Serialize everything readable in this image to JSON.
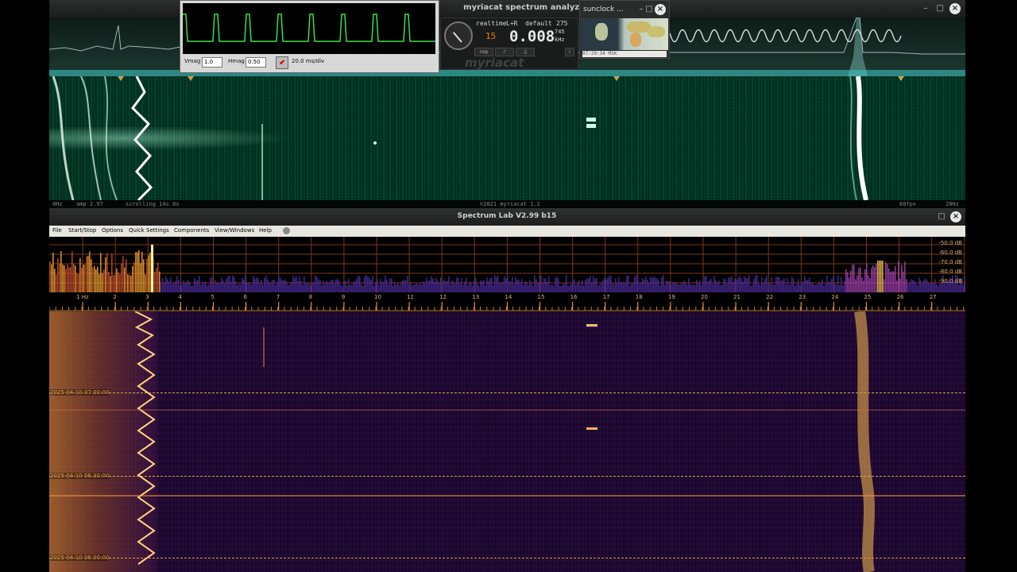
{
  "myriacat": {
    "title": "myriacat spectrum analyzer",
    "status": {
      "left_hz": "0Hz",
      "amp": "amp 2.97",
      "scrolling": "scrolling 14s 8s",
      "copyright": "©2021 myriacat 1.2",
      "fps": "60fps",
      "right_hz": "28Hz"
    },
    "panel": {
      "mode": "realtime",
      "channel": "L+R",
      "preset": "default",
      "digit": "15",
      "freq": "0.008",
      "num_top": "275",
      "num_mid": "745",
      "unit": "kHz",
      "tabs": [
        "cep",
        "♪",
        "♫"
      ],
      "logo": "myriacat"
    }
  },
  "scope": {
    "vmag_label": "Vmag",
    "vmag_value": "1.0",
    "hmag_label": "Hmag",
    "hmag_value": "0.50",
    "timebase": "20.0 ms/div"
  },
  "sunclock": {
    "title": "sunclock ...",
    "time": "07:29:34 MSK"
  },
  "speclab": {
    "title": "Spectrum Lab V2.99 b15",
    "menu": [
      "File",
      "Start/Stop",
      "Options",
      "Quick Settings",
      "Components",
      "View/Windows",
      "Help"
    ],
    "freq_labels": [
      "1 Hz",
      "2",
      "3",
      "4",
      "5",
      "6",
      "7",
      "8",
      "9",
      "10",
      "11",
      "12",
      "13",
      "14",
      "15",
      "16",
      "17",
      "18",
      "19",
      "20",
      "21",
      "22",
      "23",
      "24",
      "25",
      "26",
      "27"
    ],
    "db_labels": [
      "-50.0 dB",
      "-60.0 dB",
      "-70.0 dB",
      "-80.0 dB",
      "-90.0 dB"
    ],
    "timestamps": [
      "2025-04-10 07:00:00",
      "2025-04-10 06:30:00",
      "2025-04-10 06:00:00"
    ]
  },
  "colors": {
    "myriacat_wave": "#39e04a",
    "myriacat_bg": "#06231a",
    "speclab_accent": "#f0a030",
    "speclab_bg": "#150726"
  }
}
